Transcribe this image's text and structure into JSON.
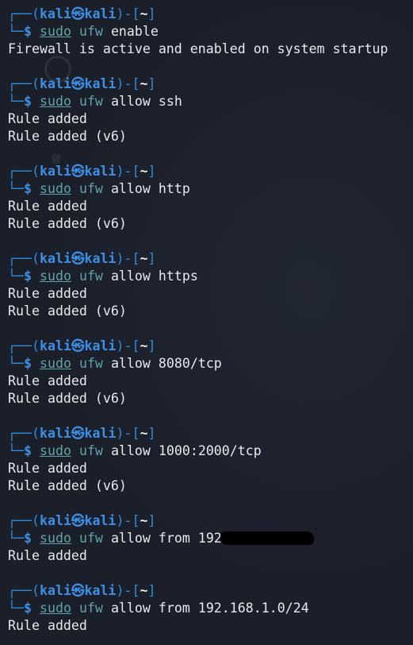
{
  "prompt": {
    "user": "kali",
    "at_symbol": "㉿",
    "host": "kali",
    "cwd": "~",
    "frame_open": "┌──(",
    "frame_mid": ")-[",
    "frame_close": "]",
    "frame_bottom": "└─",
    "symbol": "$"
  },
  "commands": [
    {
      "sudo": "sudo",
      "tool": "ufw",
      "args": "enable",
      "output": [
        "Firewall is active and enabled on system startup"
      ],
      "redacted": false
    },
    {
      "sudo": "sudo",
      "tool": "ufw",
      "args": "allow ssh",
      "output": [
        "Rule added",
        "Rule added (v6)"
      ],
      "redacted": false
    },
    {
      "sudo": "sudo",
      "tool": "ufw",
      "args": "allow http",
      "output": [
        "Rule added",
        "Rule added (v6)"
      ],
      "redacted": false
    },
    {
      "sudo": "sudo",
      "tool": "ufw",
      "args": "allow https",
      "output": [
        "Rule added",
        "Rule added (v6)"
      ],
      "redacted": false
    },
    {
      "sudo": "sudo",
      "tool": "ufw",
      "args": "allow 8080/tcp",
      "output": [
        "Rule added",
        "Rule added (v6)"
      ],
      "redacted": false
    },
    {
      "sudo": "sudo",
      "tool": "ufw",
      "args": "allow 1000:2000/tcp",
      "output": [
        "Rule added",
        "Rule added (v6)"
      ],
      "redacted": false
    },
    {
      "sudo": "sudo",
      "tool": "ufw",
      "args": "allow from 192",
      "output": [
        "Rule added"
      ],
      "redacted": true
    },
    {
      "sudo": "sudo",
      "tool": "ufw",
      "args": "allow from 192.168.1.0/24",
      "output": [
        "Rule added"
      ],
      "redacted": false
    }
  ],
  "colors": {
    "background": "#1b1f2a",
    "prompt_blue": "#3d8fe6",
    "command_teal": "#5fa3a8",
    "text": "#e7e9ee"
  }
}
